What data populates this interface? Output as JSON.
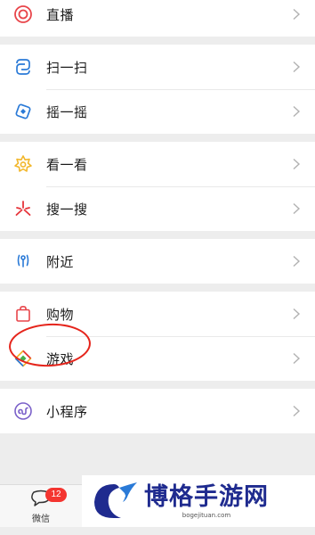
{
  "menu": {
    "live": "直播",
    "scan": "扫一扫",
    "shake": "摇一摇",
    "top_stories": "看一看",
    "search": "搜一搜",
    "nearby": "附近",
    "shopping": "购物",
    "games": "游戏",
    "mini_programs": "小程序"
  },
  "tabbar": {
    "chats_label": "微信",
    "chats_badge": "12"
  },
  "watermark": {
    "title": "博格手游网",
    "subtitle": "bogejituan.com"
  },
  "colors": {
    "background": "#ededed",
    "live_icon": "#e8454a",
    "scan_icon": "#2a7ad7",
    "top_stories_icon": "#f2b72c",
    "search_icon": "#e6343a",
    "badge": "#f43530",
    "highlight": "#e5241b"
  }
}
